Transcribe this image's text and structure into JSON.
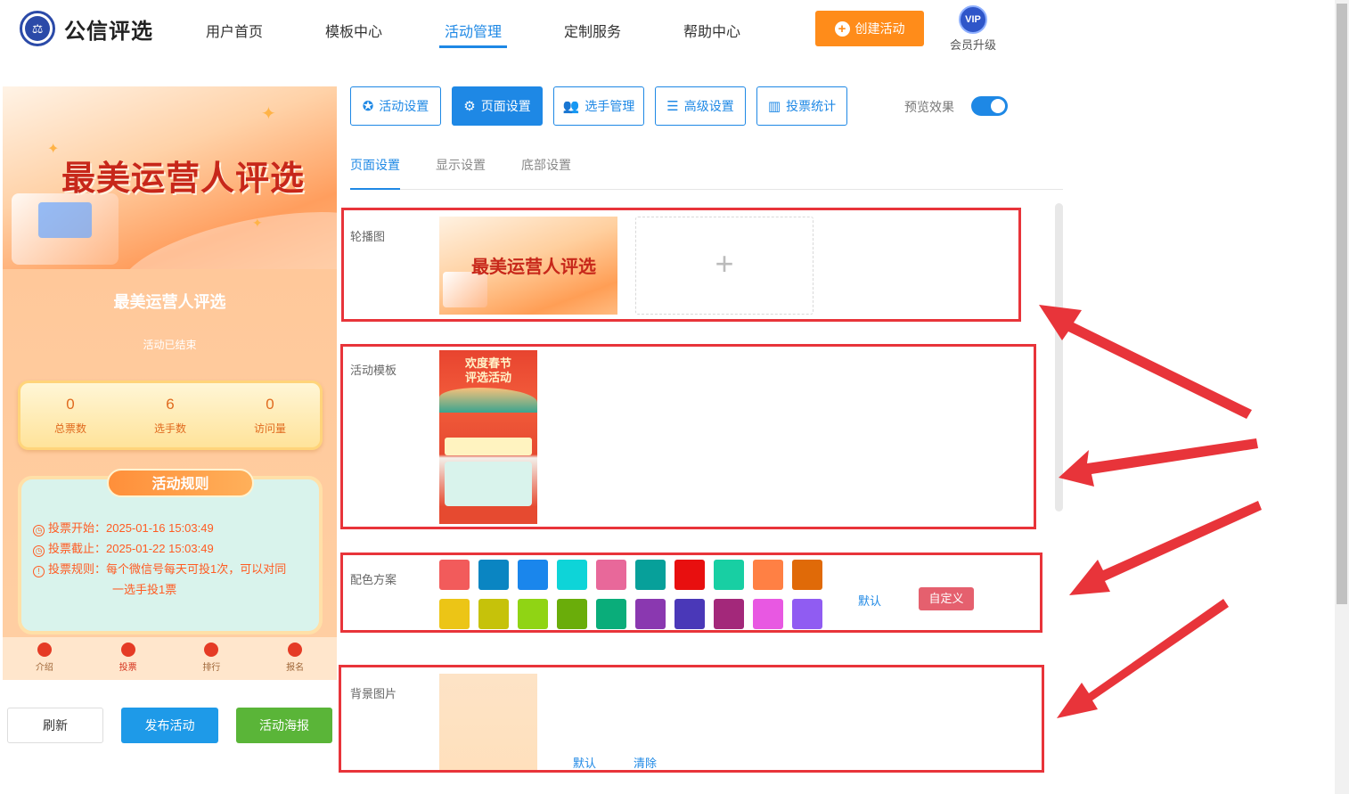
{
  "header": {
    "brand": "公信评选",
    "nav": [
      "用户首页",
      "模板中心",
      "活动管理",
      "定制服务",
      "帮助中心"
    ],
    "active_nav": "活动管理",
    "create_label": "创建活动",
    "vip_badge": "VIP",
    "vip_label": "会员升级"
  },
  "preview": {
    "banner_title": "最美运营人评选",
    "activity_name": "最美运营人评选",
    "status": "活动已结束",
    "stats": [
      {
        "value": "0",
        "label": "总票数"
      },
      {
        "value": "6",
        "label": "选手数"
      },
      {
        "value": "0",
        "label": "访问量"
      }
    ],
    "rules_title": "活动规则",
    "rules": [
      "投票开始：2025-01-16 15:03:49",
      "投票截止：2025-01-22 15:03:49",
      "投票规则：每个微信号每天可投1次，可以对同",
      "一选手投1票"
    ],
    "tabs": [
      "介绍",
      "投票",
      "排行",
      "报名"
    ],
    "active_tab": "投票"
  },
  "actions": {
    "refresh": "刷新",
    "publish": "发布活动",
    "poster": "活动海报"
  },
  "toolbar": {
    "buttons": [
      {
        "label": "活动设置",
        "icon": "star-icon"
      },
      {
        "label": "页面设置",
        "icon": "gear-icon"
      },
      {
        "label": "选手管理",
        "icon": "users-icon"
      },
      {
        "label": "高级设置",
        "icon": "advanced-settings-icon"
      },
      {
        "label": "投票统计",
        "icon": "bar-chart-icon"
      }
    ],
    "active": "页面设置",
    "preview_label": "预览效果",
    "preview_on": true
  },
  "subtabs": [
    "页面设置",
    "显示设置",
    "底部设置"
  ],
  "active_subtab": "页面设置",
  "settings": {
    "carousel_label": "轮播图",
    "carousel_image_title": "最美运营人评选",
    "upload_plus": "+",
    "template_label": "活动模板",
    "template_title_line1": "欢度春节",
    "template_title_line2": "评选活动",
    "color_label": "配色方案",
    "colors_row1": [
      "#f25b5b",
      "#0a85c2",
      "#1a86ec",
      "#0ed4d8",
      "#e8689a",
      "#07a09a",
      "#e80f0f",
      "#18cfa3",
      "#ff8044",
      "#e06a08"
    ],
    "colors_row2": [
      "#ecc516",
      "#c6c20a",
      "#90d414",
      "#6aad0a",
      "#0aad7a",
      "#8a38b0",
      "#4a38b8",
      "#a3287a",
      "#e858e2",
      "#905cf2"
    ],
    "color_default": "默认",
    "color_custom": "自定义",
    "bg_label": "背景图片",
    "bg_default": "默认",
    "bg_clear": "清除"
  }
}
